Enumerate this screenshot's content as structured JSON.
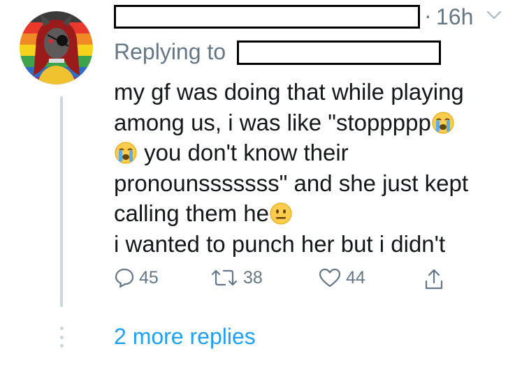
{
  "tweet": {
    "timestamp": "16h",
    "separator": "·",
    "reply_prefix": "Replying to",
    "text_lines": [
      "my gf was doing that while playing",
      "among us, i was like \"stoppppp",
      "you don't know their",
      "pronounsssssss\" and she just kept",
      "calling them he",
      "i wanted to punch her but i didn't"
    ],
    "emoji": [
      "loudly-crying-face",
      "loudly-crying-face",
      "neutral-face"
    ],
    "counts": {
      "replies": "45",
      "retweets": "38",
      "likes": "44"
    }
  },
  "thread": {
    "more_replies": "2 more replies"
  },
  "colors": {
    "text": "#14171a",
    "secondary": "#657786",
    "accent": "#1da1f2",
    "thread_line": "#ccd6dd"
  },
  "icons": [
    "reply-icon",
    "retweet-icon",
    "like-icon",
    "share-icon",
    "chevron-down-icon",
    "more-dots-icon"
  ]
}
